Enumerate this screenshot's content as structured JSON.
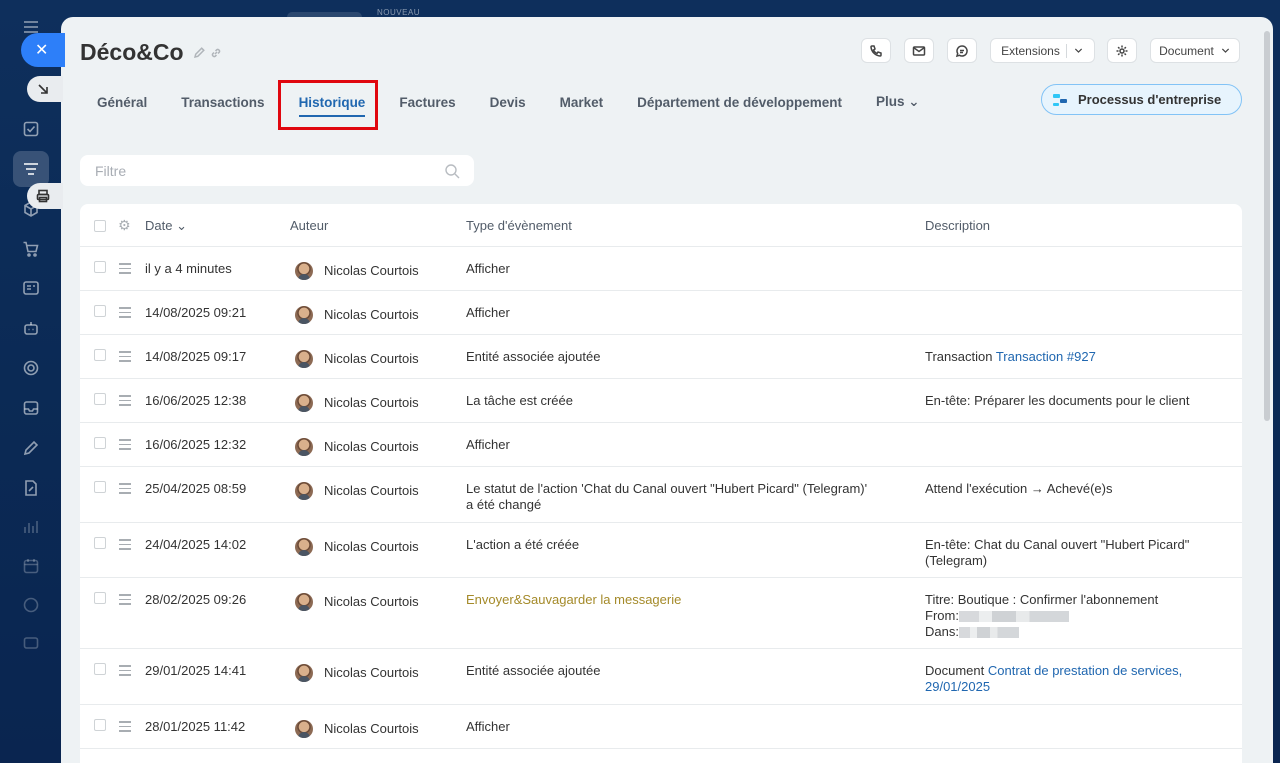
{
  "topbar": {
    "nouveau_label": "NOUVEAU"
  },
  "header": {
    "title": "Déco&Co"
  },
  "toolbar": {
    "extensions_label": "Extensions",
    "document_label": "Document"
  },
  "tabs": [
    {
      "label": "Général"
    },
    {
      "label": "Transactions"
    },
    {
      "label": "Historique"
    },
    {
      "label": "Factures"
    },
    {
      "label": "Devis"
    },
    {
      "label": "Market"
    },
    {
      "label": "Département de développement"
    },
    {
      "label": "Plus"
    }
  ],
  "process_button": {
    "label": "Processus d'entreprise"
  },
  "filter": {
    "placeholder": "Filtre"
  },
  "table": {
    "headers": {
      "date": "Date",
      "author": "Auteur",
      "event_type": "Type d'évènement",
      "description": "Description"
    },
    "rows": [
      {
        "date": "il y a 4 minutes",
        "author": "Nicolas Courtois",
        "event": "Afficher",
        "desc": "",
        "desc_link": ""
      },
      {
        "date": "14/08/2025 09:21",
        "author": "Nicolas Courtois",
        "event": "Afficher",
        "desc": "",
        "desc_link": ""
      },
      {
        "date": "14/08/2025 09:17",
        "author": "Nicolas Courtois",
        "event": "Entité associée ajoutée",
        "desc": "Transaction",
        "desc_link": "Transaction #927"
      },
      {
        "date": "16/06/2025 12:38",
        "author": "Nicolas Courtois",
        "event": "La tâche est créée",
        "desc": "En-tête: Préparer les documents pour le client",
        "desc_link": ""
      },
      {
        "date": "16/06/2025 12:32",
        "author": "Nicolas Courtois",
        "event": "Afficher",
        "desc": "",
        "desc_link": ""
      },
      {
        "date": "25/04/2025 08:59",
        "author": "Nicolas Courtois",
        "event": "Le statut de l'action 'Chat du Canal ouvert \"Hubert Picard\" (Telegram)'",
        "event2": "a été changé",
        "desc": "Attend l'exécution → Achevé(e)s",
        "desc_link": ""
      },
      {
        "date": "24/04/2025 14:02",
        "author": "Nicolas Courtois",
        "event": "L'action a été créée",
        "desc": "En-tête: Chat du Canal ouvert \"Hubert Picard\"",
        "desc2": "(Telegram)",
        "desc_link": ""
      },
      {
        "date": "28/02/2025 09:26",
        "author": "Nicolas Courtois",
        "event": "Envoyer&Sauvagarder la messagerie",
        "desc": "Titre: Boutique : Confirmer l'abonnement",
        "desc2": "From:",
        "desc3": "Dans:",
        "desc_link": ""
      },
      {
        "date": "29/01/2025 14:41",
        "author": "Nicolas Courtois",
        "event": "Entité associée ajoutée",
        "desc": "Document",
        "desc_link": "Contrat de prestation de services,",
        "desc_link2": "29/01/2025"
      },
      {
        "date": "28/01/2025 11:42",
        "author": "Nicolas Courtois",
        "event": "Afficher",
        "desc": "",
        "desc_link": ""
      }
    ]
  },
  "colors": {
    "accent": "#2067b0",
    "highlight": "#e0070f",
    "olive_text": "#a48a29",
    "close_button": "#2d7ff9"
  }
}
